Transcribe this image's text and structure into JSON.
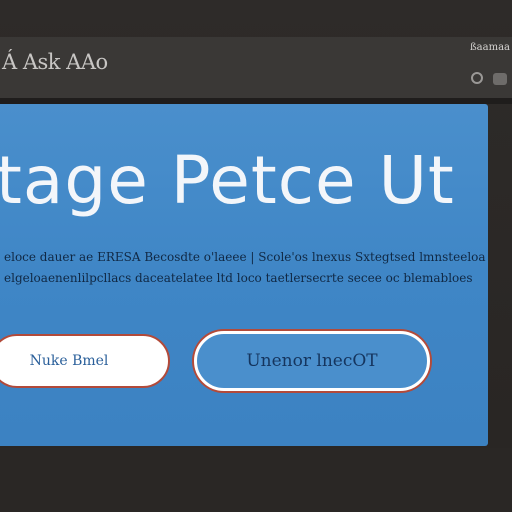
{
  "app": {
    "title": "Á Ask AAo",
    "top_right_label": "ßaamaa"
  },
  "hero": {
    "title": "tage  Petce  Ut",
    "description_line1": "eloce dauer  ae ERESA  Becosdte o'laeee | Scole'os lnexus Sxtegtsed  lmnsteeloa",
    "description_line2": "elgeloaenenlilpcllacs daceatelatee  ltd  loco taetlersecrte  secee oc  blemabloes"
  },
  "buttons": {
    "primary_label": "Nuke Bmel",
    "secondary_label": "Unenor lnecOT"
  },
  "colors": {
    "hero_blue": "#4a8fcc",
    "accent_red": "#b24a3a",
    "background_dark": "#2b2826"
  },
  "icons": {
    "account": "account-circle-icon",
    "menu": "menu-icon"
  }
}
